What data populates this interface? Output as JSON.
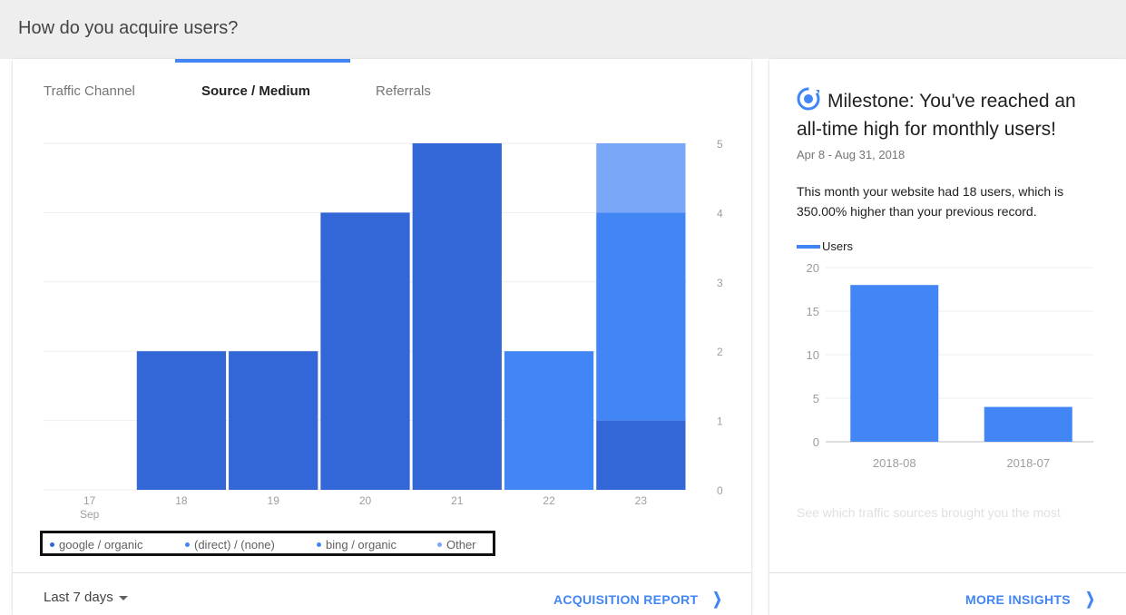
{
  "section_title": "How do you acquire users?",
  "tabs": [
    {
      "label": "Traffic Channel",
      "active": false
    },
    {
      "label": "Source / Medium",
      "active": true
    },
    {
      "label": "Referrals",
      "active": false
    }
  ],
  "colors": {
    "google_organic": "#3366d6",
    "direct_none": "#4285f4",
    "bing_organic": "#4285f4",
    "other": "#7aa7f7",
    "accent": "#4285f4"
  },
  "chart_data": [
    {
      "type": "bar",
      "stacked": true,
      "categories": [
        "17",
        "18",
        "19",
        "20",
        "21",
        "22",
        "23"
      ],
      "category_sub": [
        "Sep",
        "",
        "",
        "",
        "",
        "",
        ""
      ],
      "ylim": [
        0,
        5
      ],
      "ytick_side": "right",
      "yticks": [
        0,
        1,
        2,
        3,
        4,
        5
      ],
      "grid": true,
      "series": [
        {
          "name": "google / organic",
          "color_key": "google_organic",
          "values": [
            0,
            2,
            2,
            4,
            5,
            0,
            1
          ]
        },
        {
          "name": "(direct) / (none)",
          "color_key": "direct_none",
          "values": [
            0,
            0,
            0,
            0,
            0,
            2,
            3
          ]
        },
        {
          "name": "bing / organic",
          "color_key": "bing_organic",
          "values": [
            0,
            0,
            0,
            0,
            0,
            0,
            0
          ]
        },
        {
          "name": "Other",
          "color_key": "other",
          "values": [
            0,
            0,
            0,
            0,
            0,
            0,
            1
          ]
        }
      ],
      "legend_position": "bottom-left"
    },
    {
      "type": "bar",
      "categories": [
        "2018-08",
        "2018-07"
      ],
      "series": [
        {
          "name": "Users",
          "values": [
            18,
            4
          ]
        }
      ],
      "ylim": [
        0,
        20
      ],
      "yticks": [
        0,
        5,
        10,
        15,
        20
      ],
      "grid": true,
      "legend_position": "top-left"
    }
  ],
  "footer": {
    "date_range": "Last 7 days",
    "acquisition_link": "ACQUISITION REPORT",
    "insights_link": "MORE INSIGHTS"
  },
  "milestone": {
    "title": "Milestone: You've reached an all-time high for monthly users!",
    "dates": "Apr 8 - Aug 31, 2018",
    "body": "This month your website had 18 users, which is 350.00% higher than your previous record.",
    "faded_text": "See which traffic sources brought you the most",
    "legend_label": "Users"
  }
}
